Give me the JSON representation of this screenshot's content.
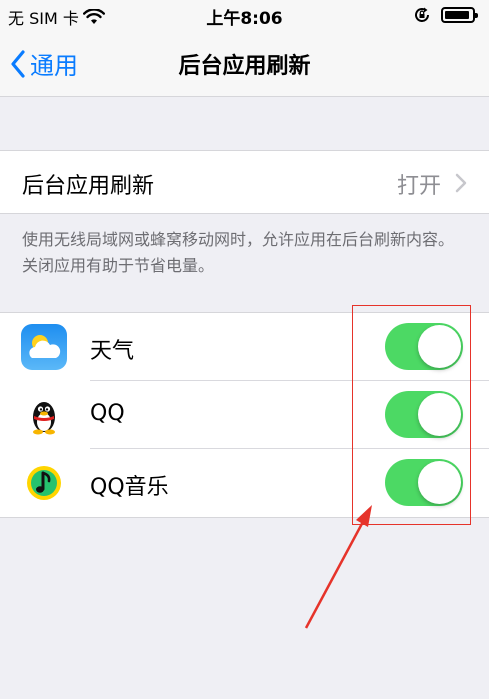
{
  "status_bar": {
    "carrier": "无 SIM 卡",
    "time": "上午8:06"
  },
  "nav": {
    "back_label": "通用",
    "title": "后台应用刷新"
  },
  "background_refresh": {
    "label": "后台应用刷新",
    "value": "打开"
  },
  "footnote": "使用无线局域网或蜂窝移动网时，允许应用在后台刷新内容。关闭应用有助于节省电量。",
  "apps": [
    {
      "name": "天气",
      "icon": "weather-icon",
      "enabled": true
    },
    {
      "name": "QQ",
      "icon": "qq-penguin-icon",
      "enabled": true
    },
    {
      "name": "QQ音乐",
      "icon": "qq-music-icon",
      "enabled": true
    }
  ],
  "colors": {
    "accent": "#0a7cff",
    "toggle_on": "#4cd964",
    "annotation": "#e6332a"
  }
}
